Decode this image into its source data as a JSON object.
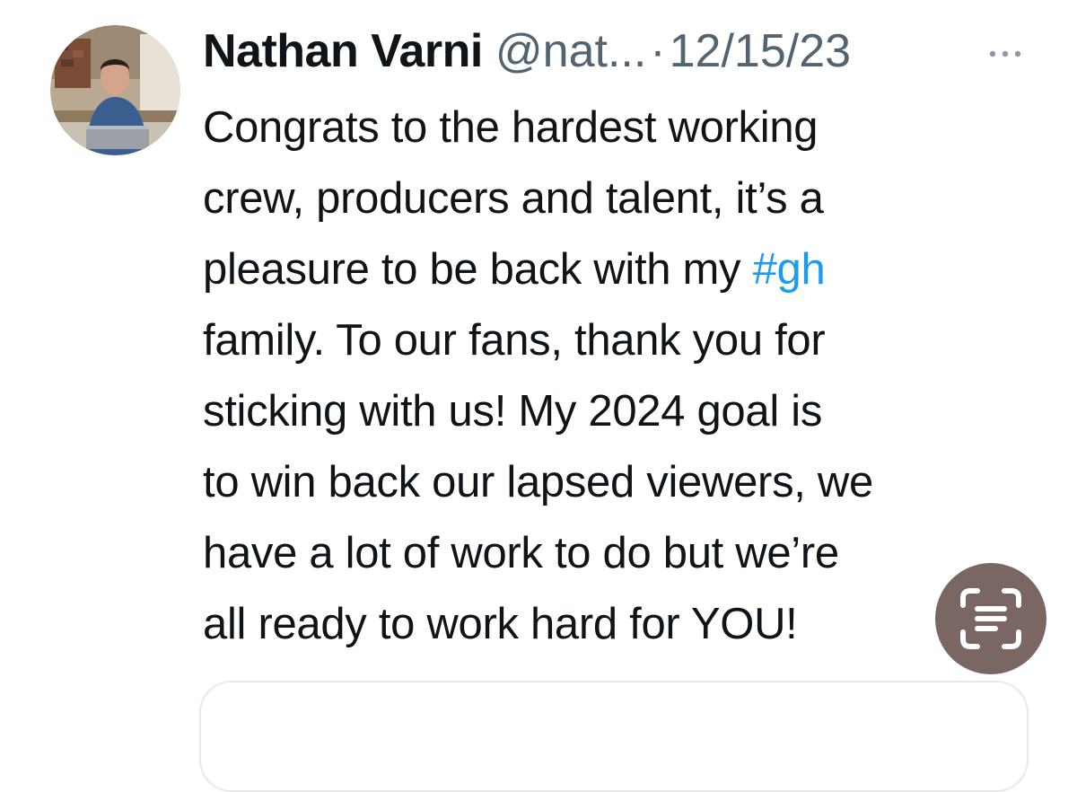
{
  "tweet": {
    "author": {
      "display_name": "Nathan Varni",
      "handle": "@nat...",
      "avatar_icon": "profile-photo"
    },
    "separator": "·",
    "date": "12/15/23",
    "more_icon": "ellipsis-icon",
    "body_lines": [
      {
        "text": "Congrats to the hardest working"
      },
      {
        "text": "crew, producers and talent, it’s a"
      },
      {
        "text": "pleasure to be back with my ",
        "hashtag": "#gh"
      },
      {
        "text": "family. To our fans, thank you for"
      },
      {
        "text": "sticking with us! My 2024 goal is"
      },
      {
        "text": "to win back our lapsed viewers, we"
      },
      {
        "text": "have a lot of work to do but we’re"
      },
      {
        "text": "all ready to work hard for YOU!"
      }
    ]
  },
  "overlay": {
    "scan_text_icon": "live-text-scan-icon"
  },
  "colors": {
    "text_primary": "#0f1419",
    "text_secondary": "#536471",
    "hashtag": "#1d9bf0",
    "overlay_button": "#7a6763",
    "card_border": "#e6e8ea"
  }
}
